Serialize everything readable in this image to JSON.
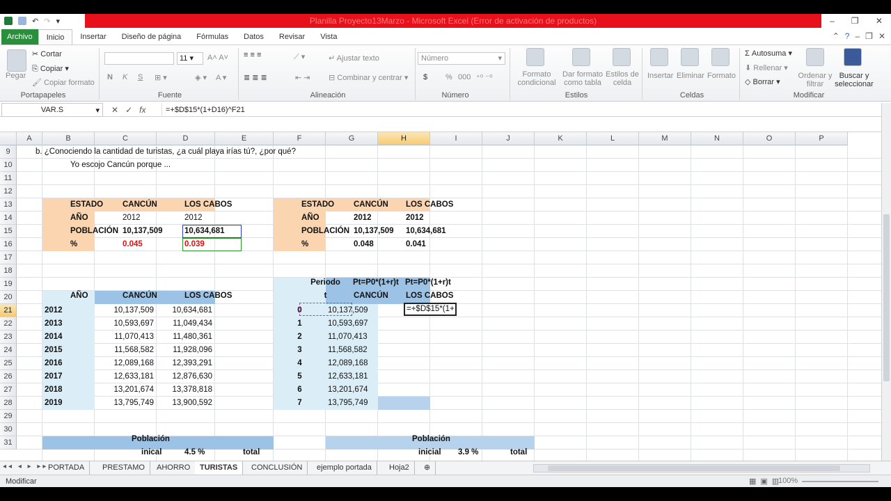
{
  "window": {
    "title": "Planilla Proyecto13Marzo - Microsoft Excel (Error de activación de productos)",
    "controls": [
      "–",
      "❐",
      "✕"
    ]
  },
  "ribbon_tabs": [
    "Archivo",
    "Inicio",
    "Insertar",
    "Diseño de página",
    "Fórmulas",
    "Datos",
    "Revisar",
    "Vista"
  ],
  "ribbon": {
    "portapapeles": {
      "label": "Portapapeles",
      "pegar": "Pegar",
      "cortar": "Cortar",
      "copiar": "Copiar",
      "copiar_formato": "Copiar formato"
    },
    "fuente": {
      "label": "Fuente",
      "size": "11",
      "bold": "N",
      "italic": "K",
      "underline": "S"
    },
    "alineacion": {
      "label": "Alineación",
      "ajustar": "Ajustar texto",
      "combinar": "Combinar y centrar"
    },
    "numero": {
      "label": "Número",
      "format": "Número",
      "currency": "$",
      "percent": "%",
      "thousands": "000"
    },
    "estilos": {
      "label": "Estilos",
      "formato_condicional": "Formato condicional",
      "dar_formato": "Dar formato como tabla",
      "estilos_celda": "Estilos de celda"
    },
    "celdas": {
      "label": "Celdas",
      "insertar": "Insertar",
      "eliminar": "Eliminar",
      "formato": "Formato"
    },
    "modificar": {
      "label": "Modificar",
      "autosuma": "Autosuma",
      "rellenar": "Rellenar",
      "borrar": "Borrar",
      "ordenar": "Ordenar y filtrar",
      "buscar": "Buscar y seleccionar"
    }
  },
  "formula_bar": {
    "name_box": "VAR.S",
    "formula": "=+$D$15*(1+D16)^F21"
  },
  "columns": [
    "A",
    "B",
    "C",
    "D",
    "E",
    "F",
    "G",
    "H",
    "I",
    "J",
    "K",
    "L",
    "M",
    "N",
    "O",
    "P"
  ],
  "rows": [
    "9",
    "10",
    "11",
    "12",
    "13",
    "14",
    "15",
    "16",
    "17",
    "18",
    "19",
    "20",
    "21",
    "22",
    "23",
    "24",
    "25",
    "26",
    "27",
    "28",
    "29",
    "30",
    "31"
  ],
  "cells": {
    "q9": "b. ¿Conociendo la cantidad de turistas, ¿a cuál playa irías tú?, ¿por qué?",
    "q10": "Yo escojo Cancún porque ...",
    "t1": {
      "h_estado": "ESTADO",
      "h_cancun": "CANCÚN",
      "h_cabos": "LOS CABOS",
      "anio": "AÑO",
      "anio_c": "2012",
      "anio_l": "2012",
      "pob": "POBLACIÓN",
      "pob_c": "10,137,509",
      "pob_l": "10,634,681",
      "pct": "%",
      "pct_c": "0.045",
      "pct_l": "0.039"
    },
    "t2": {
      "h_estado": "ESTADO",
      "h_cancun": "CANCÚN",
      "h_cabos": "LOS CABOS",
      "anio": "AÑO",
      "anio_c": "2012",
      "anio_l": "2012",
      "pob": "POBLACIÓN",
      "pob_c": "10,137,509",
      "pob_l": "10,634,681",
      "pct": "%",
      "pct_c": "0.048",
      "pct_l": "0.041"
    },
    "t3_headers": {
      "anio": "AÑO",
      "cancun": "CANCÚN",
      "cabos": "LOS CABOS"
    },
    "t3_rows": [
      [
        "2012",
        "10,137,509",
        "10,634,681"
      ],
      [
        "2013",
        "10,593,697",
        "11,049,434"
      ],
      [
        "2014",
        "11,070,413",
        "11,480,361"
      ],
      [
        "2015",
        "11,568,582",
        "11,928,096"
      ],
      [
        "2016",
        "12,089,168",
        "12,393,291"
      ],
      [
        "2017",
        "12,633,181",
        "12,876,630"
      ],
      [
        "2018",
        "13,201,674",
        "13,378,818"
      ],
      [
        "2019",
        "13,795,749",
        "13,900,592"
      ]
    ],
    "t4_headers": {
      "periodo": "Periodo",
      "t": "t",
      "formula_g": "Pt=P0*(1+r)t",
      "formula_h": "Pt=P0*(1+r)t",
      "cancun": "CANCÚN",
      "cabos": "LOS CABOS"
    },
    "t4_rows": [
      [
        "0",
        "10,137,509"
      ],
      [
        "1",
        "10,593,697"
      ],
      [
        "2",
        "11,070,413"
      ],
      [
        "3",
        "11,568,582"
      ],
      [
        "4",
        "12,089,168"
      ],
      [
        "5",
        "12,633,181"
      ],
      [
        "6",
        "13,201,674"
      ],
      [
        "7",
        "13,795,749"
      ]
    ],
    "h21_editing": "=+$D$15*(1+",
    "bottom_left": {
      "poblacion": "Población",
      "inical": "inical",
      "pct": "4.5 %",
      "total": "total"
    },
    "bottom_right": {
      "poblacion": "Población",
      "inicial": "inicial",
      "pct": "3.9 %",
      "total": "total"
    }
  },
  "sheet_tabs": [
    "PORTADA",
    "PRESTAMO",
    "AHORRO",
    "TURISTAS",
    "CONCLUSIÓN",
    "ejemplo portada",
    "Hoja2"
  ],
  "status": {
    "mode": "Modificar",
    "zoom": "100%"
  }
}
